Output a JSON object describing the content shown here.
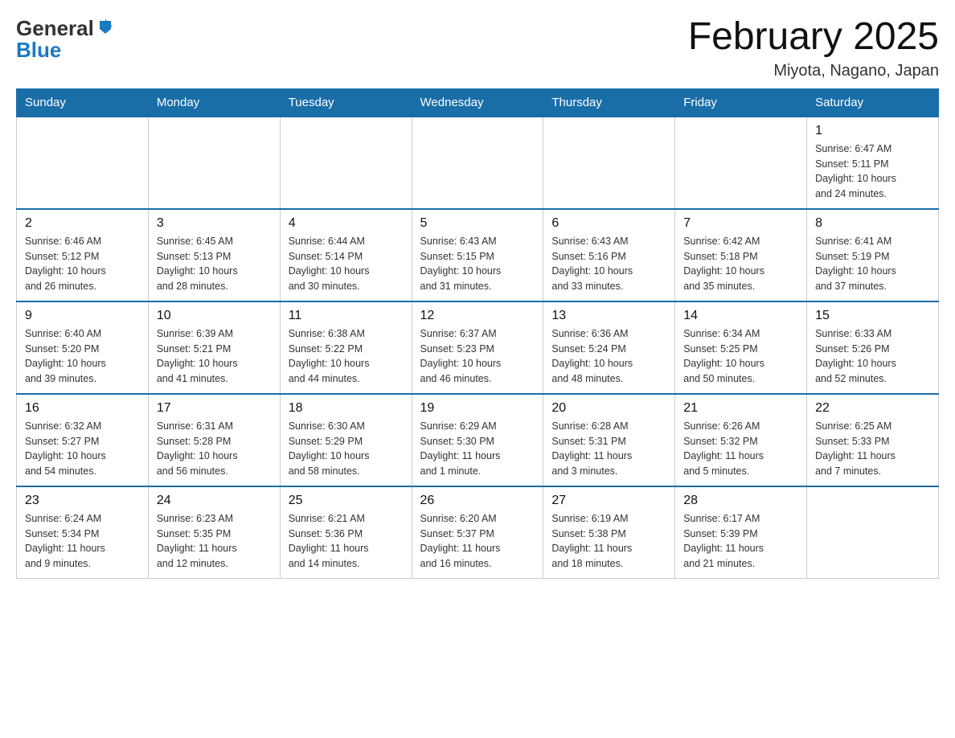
{
  "logo": {
    "general": "General",
    "blue": "Blue"
  },
  "title": "February 2025",
  "location": "Miyota, Nagano, Japan",
  "weekdays": [
    "Sunday",
    "Monday",
    "Tuesday",
    "Wednesday",
    "Thursday",
    "Friday",
    "Saturday"
  ],
  "weeks": [
    [
      {
        "day": "",
        "info": ""
      },
      {
        "day": "",
        "info": ""
      },
      {
        "day": "",
        "info": ""
      },
      {
        "day": "",
        "info": ""
      },
      {
        "day": "",
        "info": ""
      },
      {
        "day": "",
        "info": ""
      },
      {
        "day": "1",
        "info": "Sunrise: 6:47 AM\nSunset: 5:11 PM\nDaylight: 10 hours\nand 24 minutes."
      }
    ],
    [
      {
        "day": "2",
        "info": "Sunrise: 6:46 AM\nSunset: 5:12 PM\nDaylight: 10 hours\nand 26 minutes."
      },
      {
        "day": "3",
        "info": "Sunrise: 6:45 AM\nSunset: 5:13 PM\nDaylight: 10 hours\nand 28 minutes."
      },
      {
        "day": "4",
        "info": "Sunrise: 6:44 AM\nSunset: 5:14 PM\nDaylight: 10 hours\nand 30 minutes."
      },
      {
        "day": "5",
        "info": "Sunrise: 6:43 AM\nSunset: 5:15 PM\nDaylight: 10 hours\nand 31 minutes."
      },
      {
        "day": "6",
        "info": "Sunrise: 6:43 AM\nSunset: 5:16 PM\nDaylight: 10 hours\nand 33 minutes."
      },
      {
        "day": "7",
        "info": "Sunrise: 6:42 AM\nSunset: 5:18 PM\nDaylight: 10 hours\nand 35 minutes."
      },
      {
        "day": "8",
        "info": "Sunrise: 6:41 AM\nSunset: 5:19 PM\nDaylight: 10 hours\nand 37 minutes."
      }
    ],
    [
      {
        "day": "9",
        "info": "Sunrise: 6:40 AM\nSunset: 5:20 PM\nDaylight: 10 hours\nand 39 minutes."
      },
      {
        "day": "10",
        "info": "Sunrise: 6:39 AM\nSunset: 5:21 PM\nDaylight: 10 hours\nand 41 minutes."
      },
      {
        "day": "11",
        "info": "Sunrise: 6:38 AM\nSunset: 5:22 PM\nDaylight: 10 hours\nand 44 minutes."
      },
      {
        "day": "12",
        "info": "Sunrise: 6:37 AM\nSunset: 5:23 PM\nDaylight: 10 hours\nand 46 minutes."
      },
      {
        "day": "13",
        "info": "Sunrise: 6:36 AM\nSunset: 5:24 PM\nDaylight: 10 hours\nand 48 minutes."
      },
      {
        "day": "14",
        "info": "Sunrise: 6:34 AM\nSunset: 5:25 PM\nDaylight: 10 hours\nand 50 minutes."
      },
      {
        "day": "15",
        "info": "Sunrise: 6:33 AM\nSunset: 5:26 PM\nDaylight: 10 hours\nand 52 minutes."
      }
    ],
    [
      {
        "day": "16",
        "info": "Sunrise: 6:32 AM\nSunset: 5:27 PM\nDaylight: 10 hours\nand 54 minutes."
      },
      {
        "day": "17",
        "info": "Sunrise: 6:31 AM\nSunset: 5:28 PM\nDaylight: 10 hours\nand 56 minutes."
      },
      {
        "day": "18",
        "info": "Sunrise: 6:30 AM\nSunset: 5:29 PM\nDaylight: 10 hours\nand 58 minutes."
      },
      {
        "day": "19",
        "info": "Sunrise: 6:29 AM\nSunset: 5:30 PM\nDaylight: 11 hours\nand 1 minute."
      },
      {
        "day": "20",
        "info": "Sunrise: 6:28 AM\nSunset: 5:31 PM\nDaylight: 11 hours\nand 3 minutes."
      },
      {
        "day": "21",
        "info": "Sunrise: 6:26 AM\nSunset: 5:32 PM\nDaylight: 11 hours\nand 5 minutes."
      },
      {
        "day": "22",
        "info": "Sunrise: 6:25 AM\nSunset: 5:33 PM\nDaylight: 11 hours\nand 7 minutes."
      }
    ],
    [
      {
        "day": "23",
        "info": "Sunrise: 6:24 AM\nSunset: 5:34 PM\nDaylight: 11 hours\nand 9 minutes."
      },
      {
        "day": "24",
        "info": "Sunrise: 6:23 AM\nSunset: 5:35 PM\nDaylight: 11 hours\nand 12 minutes."
      },
      {
        "day": "25",
        "info": "Sunrise: 6:21 AM\nSunset: 5:36 PM\nDaylight: 11 hours\nand 14 minutes."
      },
      {
        "day": "26",
        "info": "Sunrise: 6:20 AM\nSunset: 5:37 PM\nDaylight: 11 hours\nand 16 minutes."
      },
      {
        "day": "27",
        "info": "Sunrise: 6:19 AM\nSunset: 5:38 PM\nDaylight: 11 hours\nand 18 minutes."
      },
      {
        "day": "28",
        "info": "Sunrise: 6:17 AM\nSunset: 5:39 PM\nDaylight: 11 hours\nand 21 minutes."
      },
      {
        "day": "",
        "info": ""
      }
    ]
  ]
}
